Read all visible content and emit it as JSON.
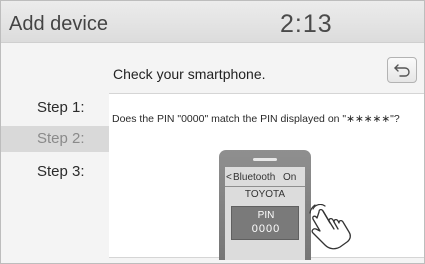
{
  "header": {
    "title": "Add device",
    "time": "2:13"
  },
  "instruction": "Check your smartphone.",
  "back_button": {
    "icon": "return-arrow-icon"
  },
  "steps": [
    {
      "label": "Step 1:",
      "active": false
    },
    {
      "label": "Step 2:",
      "active": true
    },
    {
      "label": "Step 3:",
      "active": false
    }
  ],
  "question": "Does the PIN \"0000\" match the PIN displayed on \"∗∗∗∗∗\"?",
  "phone": {
    "bluetooth_label": "Bluetooth",
    "bluetooth_chevron": "<",
    "bluetooth_status": "On",
    "device_name": "TOYOTA",
    "pin_label": "PIN",
    "pin_code": "0000"
  },
  "colors": {
    "header_bg": "#dcdcdc",
    "active_step_bg": "#d9d9d9",
    "phone_body": "#858585",
    "pin_box": "#7a7a7a"
  }
}
